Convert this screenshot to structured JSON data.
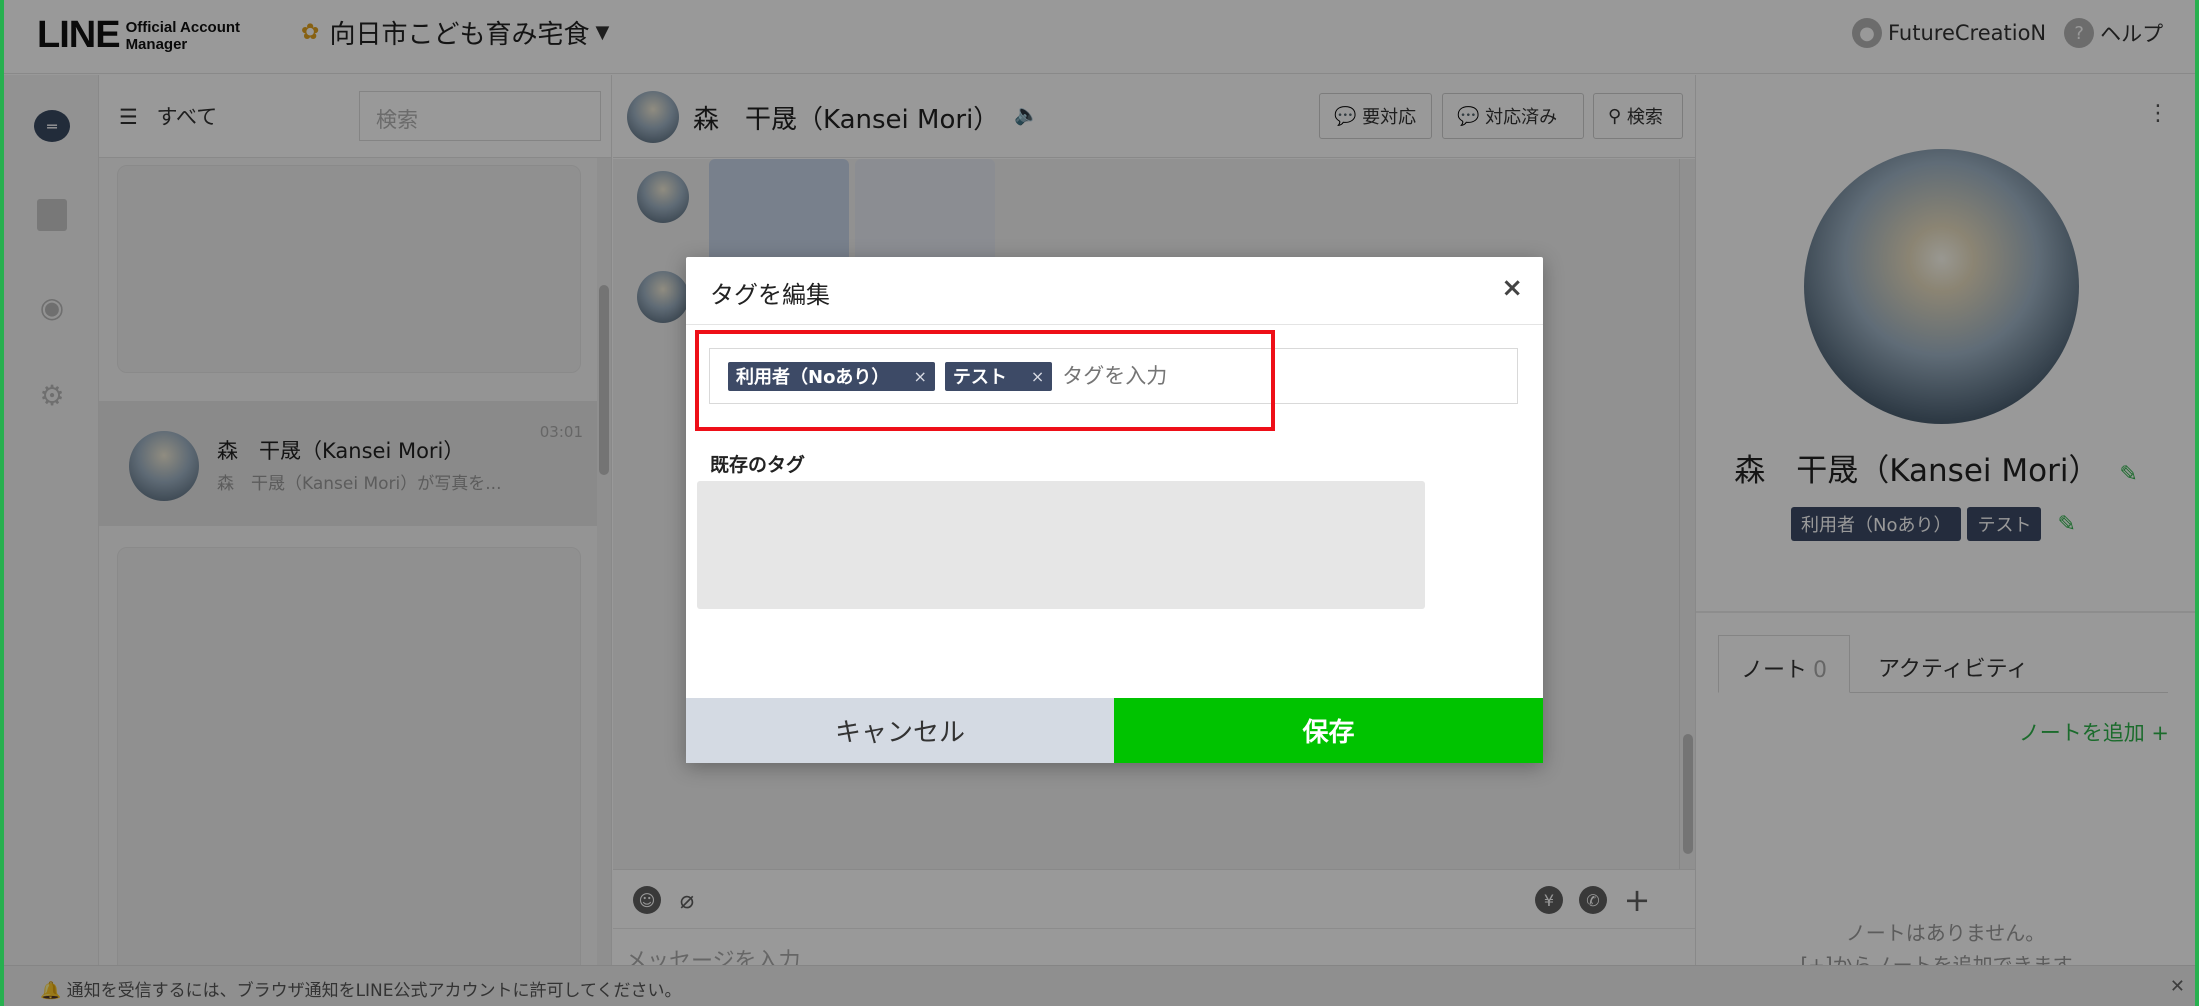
{
  "header": {
    "logo_main": "LINE",
    "logo_sub_line1": "Official Account",
    "logo_sub_line2": "Manager",
    "account_name": "向日市こども育み宅食",
    "user_name": "FutureCreatioN",
    "help_label": "ヘルプ"
  },
  "chat_list": {
    "filter_label": "すべて",
    "search_placeholder": "検索",
    "item": {
      "name": "森　干晟（Kansei Mori）",
      "preview": "森　干晟（Kansei Mori）が写真を...",
      "time": "03:01"
    }
  },
  "chat": {
    "contact_name": "森　干晟（Kansei Mori）",
    "buttons": {
      "require": "要対応",
      "done": "対応済み",
      "search": "検索"
    },
    "input_placeholder": "メッセージを入力"
  },
  "profile": {
    "name": "森　干晟（Kansei Mori）",
    "tags": [
      "利用者（Noあり）",
      "テスト"
    ],
    "tabs": {
      "note": "ノート",
      "note_count": "0",
      "activity": "アクティビティ"
    },
    "add_note": "ノートを追加",
    "empty_line1": "ノートはありません。",
    "empty_line2": "[+]からノートを追加できます。"
  },
  "notification": {
    "text": "通知を受信するには、ブラウザ通知をLINE公式アカウントに許可してください。"
  },
  "modal": {
    "title": "タグを編集",
    "tags": [
      "利用者（Noあり）",
      "テスト"
    ],
    "tag_input_placeholder": "タグを入力",
    "existing_tags_title": "既存のタグ",
    "cancel_label": "キャンセル",
    "save_label": "保存"
  },
  "colors": {
    "line_green": "#00c300",
    "tag_bg": "#3d4a66",
    "highlight_red": "#ee0f18"
  }
}
